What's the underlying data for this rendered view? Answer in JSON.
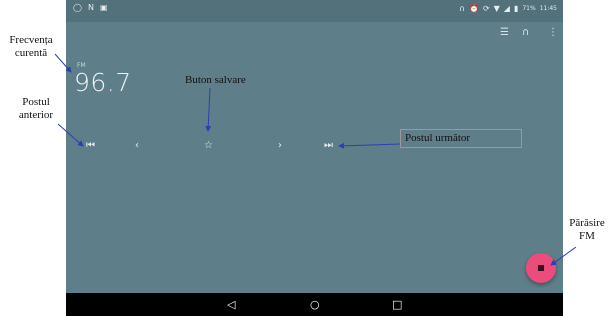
{
  "status_bar": {
    "left_icons": [
      "circle-icon",
      "n-icon",
      "image-icon"
    ],
    "battery": "71%",
    "time": "11:45"
  },
  "toolbar": {
    "icons": [
      "list-icon",
      "headset-icon",
      "more-vert-icon"
    ]
  },
  "radio": {
    "band": "FM",
    "frequency": "96.7"
  },
  "controls": {
    "icons": [
      "skip-previous-icon",
      "chevron-left-icon",
      "star-icon",
      "chevron-right-icon",
      "skip-next-icon"
    ]
  },
  "nav_bar": {
    "icons": [
      "back-icon",
      "home-icon",
      "recents-icon"
    ]
  },
  "annotations": {
    "current_frequency": [
      "Frecvența",
      "curentă"
    ],
    "save_button": "Buton salvare",
    "previous_station": [
      "Postul",
      "anterior"
    ],
    "next_station": "Postul următor",
    "exit_fm": [
      "Părăsire",
      "FM"
    ]
  },
  "colors": {
    "screen_bg": "#5e7f89",
    "fab": "#ea4c7b",
    "arrow": "#2b3fb0"
  }
}
